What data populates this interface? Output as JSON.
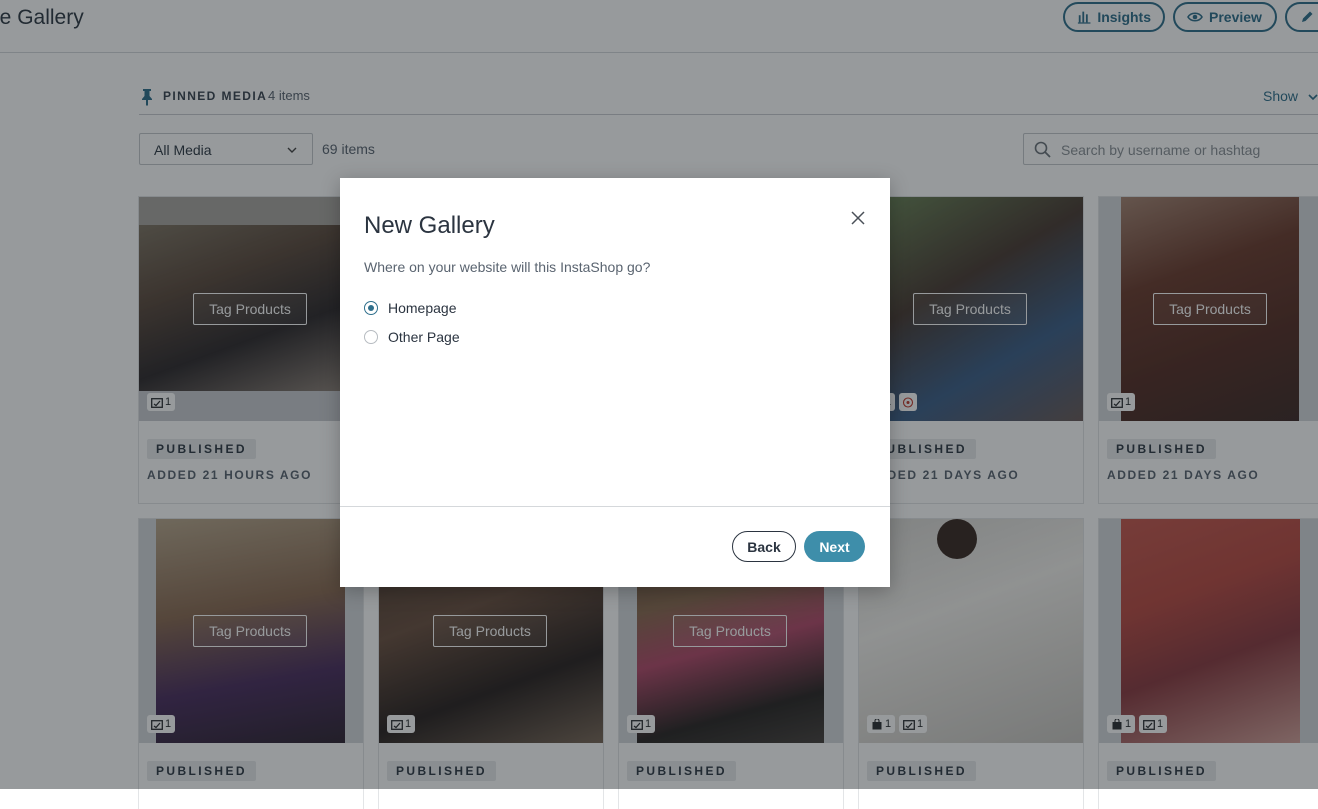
{
  "header": {
    "title": "ge Gallery",
    "insights_label": "Insights",
    "preview_label": "Preview"
  },
  "pinned": {
    "label": "PINNED MEDIA",
    "count": "4 items",
    "show_label": "Show"
  },
  "filter": {
    "media_select_value": "All Media",
    "items_count": "69 items",
    "search_placeholder": "Search by username or hashtag"
  },
  "cards": [
    {
      "tag_label": "Tag Products",
      "badges": [
        "1"
      ],
      "status": "PUBLISHED",
      "added": "ADDED 21 HOURS AGO"
    },
    {
      "tag_label": "Tag Products",
      "badges": [
        "1"
      ],
      "status": "PUBLISHED",
      "added": "ADDED 21 DAYS AGO"
    },
    {
      "tag_label": "Tag Products",
      "badges": [
        "1"
      ],
      "status": "PUBLISHED",
      "added": "ADDED 21 DAYS AGO"
    },
    {
      "tag_label": "Tag Products",
      "badges": [
        "1"
      ],
      "status": "PUBLISHED",
      "added": ""
    },
    {
      "tag_label": "Tag Products",
      "badges": [
        "1"
      ],
      "status": "PUBLISHED",
      "added": ""
    },
    {
      "tag_label": "Tag Products",
      "badges": [
        "1"
      ],
      "status": "PUBLISHED",
      "added": ""
    },
    {
      "tag_label": "",
      "badges": [
        "1",
        "1"
      ],
      "status": "PUBLISHED",
      "added": ""
    },
    {
      "tag_label": "",
      "badges": [
        "1",
        "1"
      ],
      "status": "PUBLISHED",
      "added": ""
    }
  ],
  "modal": {
    "title": "New Gallery",
    "question": "Where on your website will this InstaShop go?",
    "options": [
      "Homepage",
      "Other Page"
    ],
    "selected_option": "Homepage",
    "back_label": "Back",
    "next_label": "Next"
  },
  "colors": {
    "accent": "#2f6f8c",
    "next_button": "#3e8eaa",
    "overlay": "#12181e"
  }
}
